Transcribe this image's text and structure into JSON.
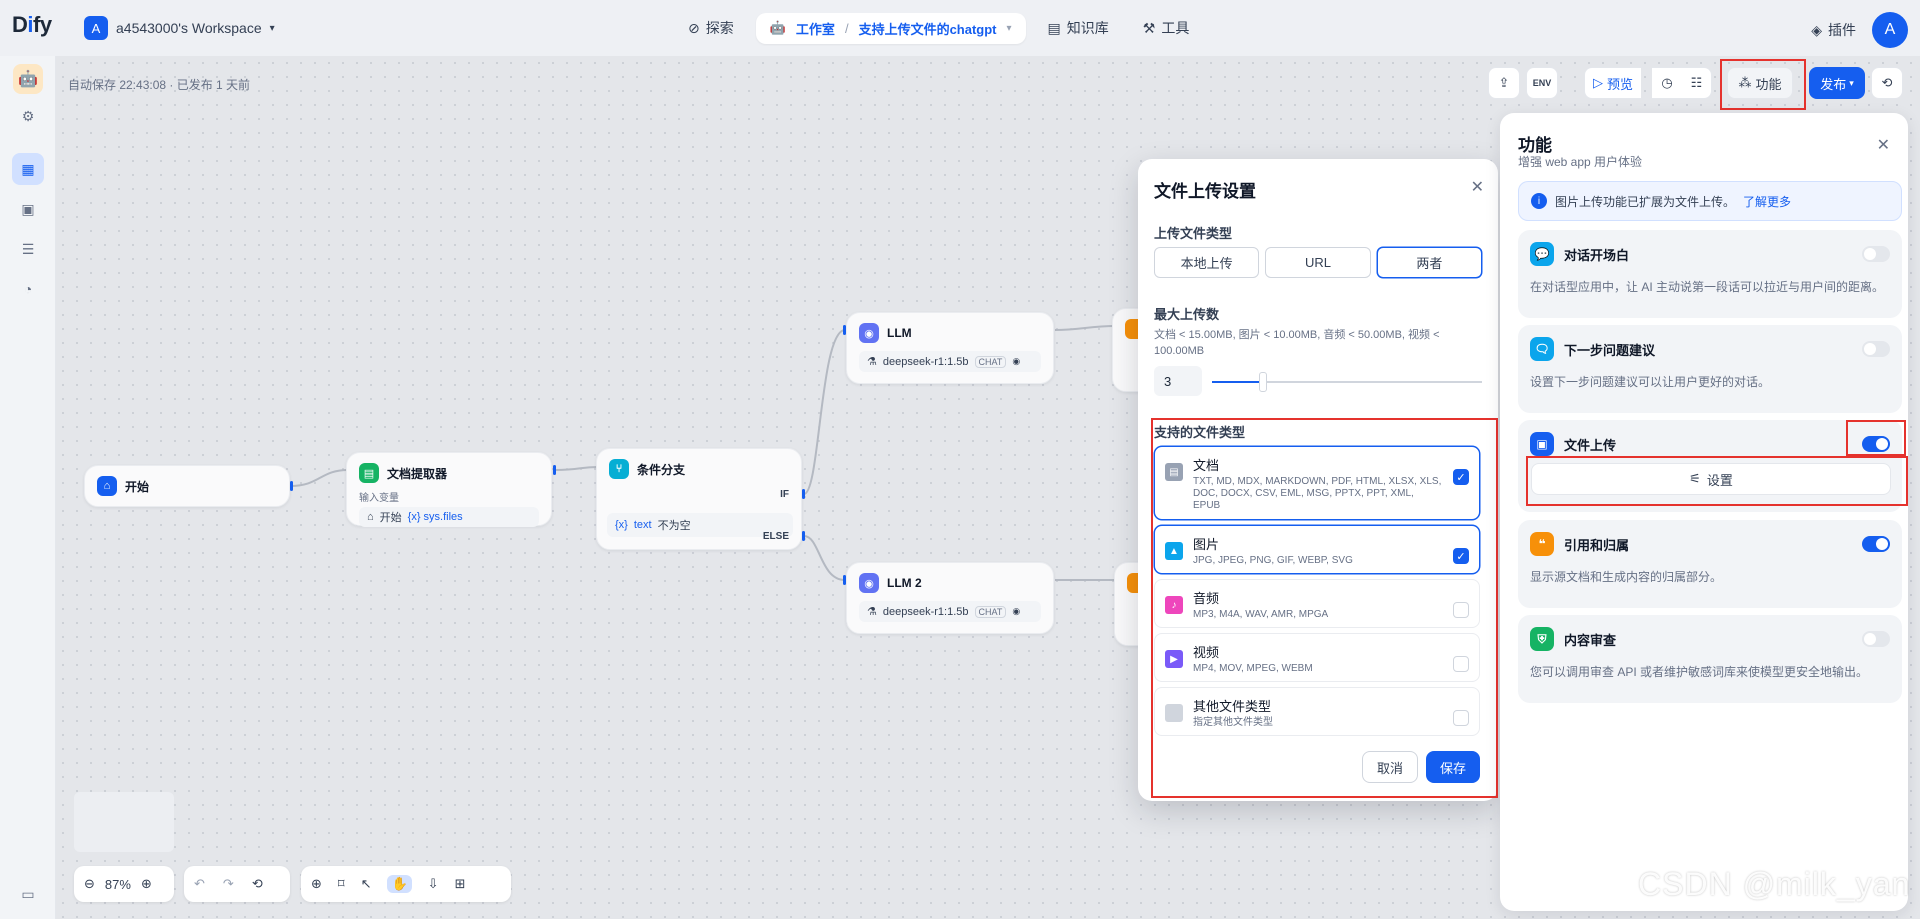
{
  "nav": {
    "logo": "Dify",
    "workspace_initial": "A",
    "workspace": "a4543000's Workspace",
    "explore": "探索",
    "studio": "工作室",
    "app_name": "支持上传文件的chatgpt",
    "knowledge": "知识库",
    "tools": "工具",
    "plugins": "插件",
    "user_initial": "A"
  },
  "status": {
    "autosave": "自动保存 22:43:08 · 已发布 1 天前"
  },
  "toolbar": {
    "env": "ENV",
    "preview": "预览",
    "features": "功能",
    "publish": "发布"
  },
  "nodes": {
    "start": {
      "title": "开始"
    },
    "extractor": {
      "title": "文档提取器",
      "label": "输入变量",
      "var_src": "开始",
      "var": "{x} sys.files"
    },
    "branch": {
      "title": "条件分支",
      "if": "IF",
      "else": "ELSE",
      "cond_var": "{x}",
      "cond_name": "text",
      "cond_op": "不为空"
    },
    "llm1": {
      "title": "LLM",
      "model": "deepseek-r1:1.5b",
      "tag": "CHAT"
    },
    "llm2": {
      "title": "LLM 2",
      "model": "deepseek-r1:1.5b",
      "tag": "CHAT"
    }
  },
  "zoom": {
    "level": "87%"
  },
  "modal": {
    "title": "文件上传设置",
    "upload_type_label": "上传文件类型",
    "upload_options": [
      "本地上传",
      "URL",
      "两者"
    ],
    "selected_option": "两者",
    "max_label": "最大上传数",
    "limits": "文档 < 15.00MB, 图片 < 10.00MB, 音频 < 50.00MB, 视频 < 100.00MB",
    "max_value": "3",
    "slider_fraction": 0.19,
    "types_label": "支持的文件类型",
    "types": [
      {
        "name": "文档",
        "desc": "TXT, MD, MDX, MARKDOWN, PDF, HTML, XLSX, XLS, DOC, DOCX, CSV, EML, MSG, PPTX, PPT, XML, EPUB",
        "checked": true,
        "color": "#98a2b3"
      },
      {
        "name": "图片",
        "desc": "JPG, JPEG, PNG, GIF, WEBP, SVG",
        "checked": true,
        "color": "#0ba5ec"
      },
      {
        "name": "音频",
        "desc": "MP3, M4A, WAV, AMR, MPGA",
        "checked": false,
        "color": "#ee46bc"
      },
      {
        "name": "视频",
        "desc": "MP4, MOV, MPEG, WEBM",
        "checked": false,
        "color": "#7a5af8"
      },
      {
        "name": "其他文件类型",
        "desc": "指定其他文件类型",
        "checked": false,
        "color": "#d0d5dd"
      }
    ],
    "cancel": "取消",
    "save": "保存"
  },
  "features": {
    "title": "功能",
    "subtitle": "增强 web app 用户体验",
    "info": "图片上传功能已扩展为文件上传。",
    "info_link": "了解更多",
    "items": [
      {
        "name": "对话开场白",
        "desc": "在对话型应用中，让 AI 主动说第一段话可以拉近与用户间的距离。",
        "on": false,
        "color": "#0ba5ec"
      },
      {
        "name": "下一步问题建议",
        "desc": "设置下一步问题建议可以让用户更好的对话。",
        "on": false,
        "color": "#0ba5ec"
      },
      {
        "name": "文件上传",
        "desc": "",
        "on": true,
        "color": "#155eef"
      },
      {
        "name": "引用和归属",
        "desc": "显示源文档和生成内容的归属部分。",
        "on": true,
        "color": "#f79009"
      },
      {
        "name": "内容审查",
        "desc": "您可以调用审查 API 或者维护敏感词库来使模型更安全地输出。",
        "on": false,
        "color": "#16b364"
      }
    ],
    "settings_btn": "设置"
  },
  "watermark": "CSDN @milk_yan"
}
